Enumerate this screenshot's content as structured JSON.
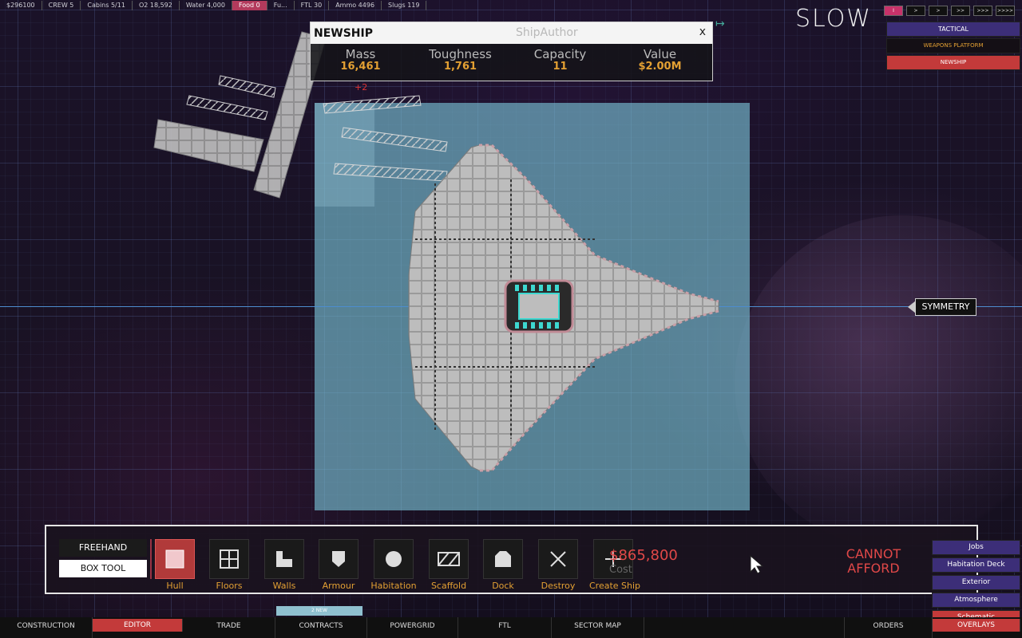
{
  "top_stats": [
    {
      "label": "$296100",
      "highlight": false
    },
    {
      "label": "CREW 5",
      "highlight": false
    },
    {
      "label": "Cabins 5/11",
      "highlight": false
    },
    {
      "label": "O2 18,592",
      "highlight": false
    },
    {
      "label": "Water 4,000",
      "highlight": false
    },
    {
      "label": "Food 0",
      "highlight": true
    },
    {
      "label": "Fu...",
      "highlight": false
    },
    {
      "label": "FTL 30",
      "highlight": false
    },
    {
      "label": "Ammo 4496",
      "highlight": false
    },
    {
      "label": "Slugs 119",
      "highlight": false
    }
  ],
  "game_speed": "SLOW",
  "speed_buttons": [
    "I",
    ">",
    ">",
    ">>",
    ">>>",
    ">>>>"
  ],
  "right_menu": {
    "tactical": "TACTICAL",
    "weapons_platform": "WEAPONS PLATFORM",
    "newship": "NEWSHIP"
  },
  "ship_panel": {
    "name": "NEWSHIP",
    "author": "ShipAuthor",
    "close": "x",
    "stats": [
      {
        "label": "Mass",
        "value": "16,461"
      },
      {
        "label": "Toughness",
        "value": "1,761"
      },
      {
        "label": "Capacity",
        "value": "11"
      },
      {
        "label": "Value",
        "value": "$2.00M"
      }
    ]
  },
  "plus_marker": "+2",
  "symmetry_label": "SYMMETRY",
  "toolbar": {
    "freehand": "FREEHAND",
    "box_tool": "BOX TOOL",
    "tools": [
      "Hull",
      "Floors",
      "Walls",
      "Armour",
      "Habitation",
      "Scaffold",
      "Dock",
      "Destroy",
      "Create Ship"
    ],
    "selected_tool": "Hull",
    "cost_value": "$865,800",
    "cost_label": "Cost",
    "cannot_afford": "CANNOT AFFORD"
  },
  "overlay_menu": [
    "Jobs",
    "Habitation Deck",
    "Exterior",
    "Atmosphere",
    "Schematic"
  ],
  "new_tag": "2 NEW",
  "bottom_nav": [
    "CONSTRUCTION",
    "EDITOR",
    "TRADE",
    "CONTRACTS",
    "POWERGRID",
    "FTL",
    "SECTOR MAP",
    "ORDERS",
    "OVERLAYS"
  ],
  "selected_nav": "EDITOR",
  "colors": {
    "accent_red": "#c33a3a",
    "accent_purple": "#3c2e78",
    "value_orange": "#e3a033",
    "build_area": "#7fbfd3"
  }
}
